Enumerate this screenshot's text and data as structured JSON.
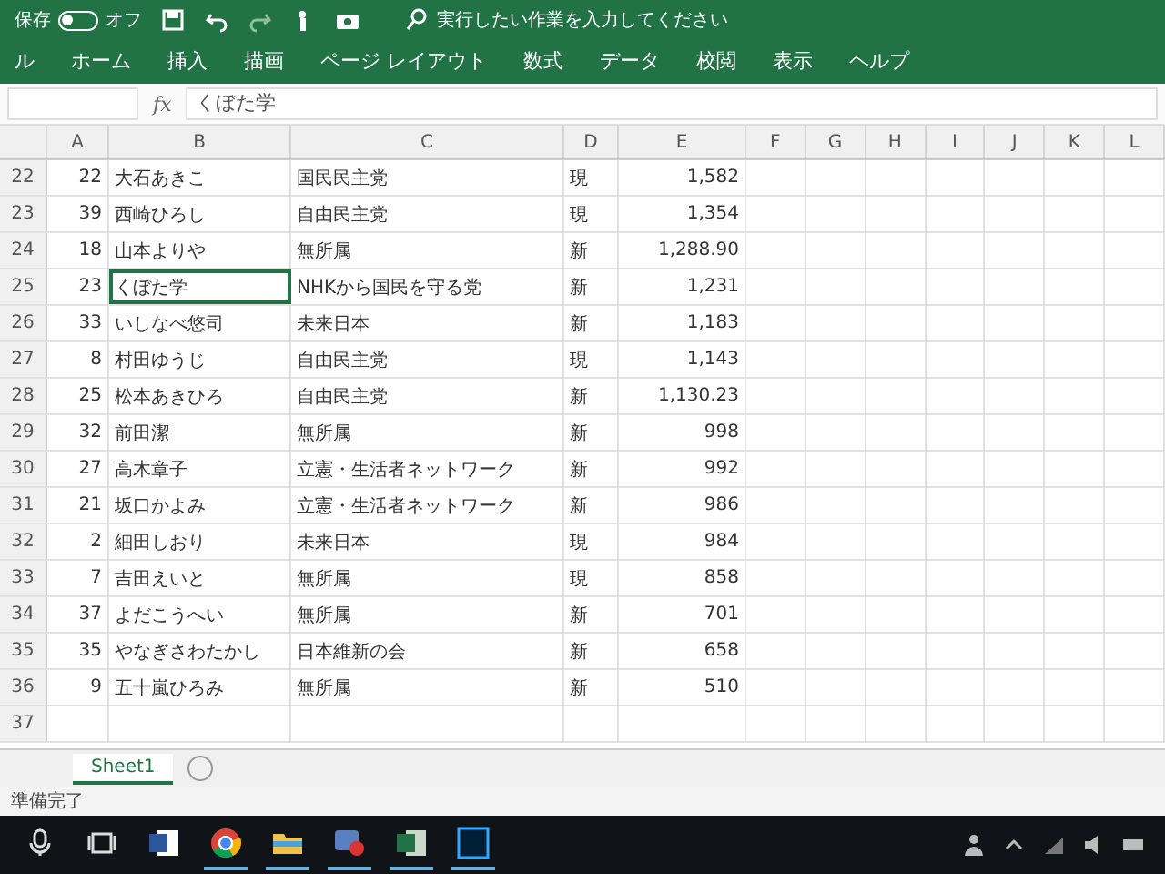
{
  "autosave": {
    "label": "保存",
    "state": "オフ",
    "on": false
  },
  "search": {
    "placeholder": "実行したい作業を入力してください"
  },
  "ribbon_tabs": [
    {
      "label": "ル",
      "selected": false
    },
    {
      "label": "ホーム",
      "selected": false
    },
    {
      "label": "挿入",
      "selected": false
    },
    {
      "label": "描画",
      "selected": false
    },
    {
      "label": "ページ レイアウト",
      "selected": false
    },
    {
      "label": "数式",
      "selected": false
    },
    {
      "label": "データ",
      "selected": false
    },
    {
      "label": "校閲",
      "selected": false
    },
    {
      "label": "表示",
      "selected": false
    },
    {
      "label": "ヘルプ",
      "selected": false
    }
  ],
  "formula_bar": {
    "fx": "fx",
    "value": "くぼた学"
  },
  "columns": [
    "A",
    "B",
    "C",
    "D",
    "E",
    "F",
    "G",
    "H",
    "I",
    "J",
    "K",
    "L"
  ],
  "rows": [
    {
      "row": "22",
      "a": "22",
      "b": "大石あきこ",
      "c": "国民民主党",
      "d": "現",
      "e": "1,582",
      "selected": false
    },
    {
      "row": "23",
      "a": "39",
      "b": "西崎ひろし",
      "c": "自由民主党",
      "d": "現",
      "e": "1,354",
      "selected": false
    },
    {
      "row": "24",
      "a": "18",
      "b": "山本よりや",
      "c": "無所属",
      "d": "新",
      "e": "1,288.90",
      "selected": false
    },
    {
      "row": "25",
      "a": "23",
      "b": "くぼた学",
      "c": "NHKから国民を守る党",
      "d": "新",
      "e": "1,231",
      "selected": true
    },
    {
      "row": "26",
      "a": "33",
      "b": "いしなべ悠司",
      "c": "未来日本",
      "d": "新",
      "e": "1,183",
      "selected": false
    },
    {
      "row": "27",
      "a": "8",
      "b": "村田ゆうじ",
      "c": "自由民主党",
      "d": "現",
      "e": "1,143",
      "selected": false
    },
    {
      "row": "28",
      "a": "25",
      "b": "松本あきひろ",
      "c": "自由民主党",
      "d": "新",
      "e": "1,130.23",
      "selected": false
    },
    {
      "row": "29",
      "a": "32",
      "b": "前田潔",
      "c": "無所属",
      "d": "新",
      "e": "998",
      "selected": false
    },
    {
      "row": "30",
      "a": "27",
      "b": "高木章子",
      "c": "立憲・生活者ネットワーク",
      "d": "新",
      "e": "992",
      "selected": false
    },
    {
      "row": "31",
      "a": "21",
      "b": "坂口かよみ",
      "c": "立憲・生活者ネットワーク",
      "d": "新",
      "e": "986",
      "selected": false
    },
    {
      "row": "32",
      "a": "2",
      "b": "細田しおり",
      "c": "未来日本",
      "d": "現",
      "e": "984",
      "selected": false
    },
    {
      "row": "33",
      "a": "7",
      "b": "吉田えいと",
      "c": "無所属",
      "d": "現",
      "e": "858",
      "selected": false
    },
    {
      "row": "34",
      "a": "37",
      "b": "よだこうへい",
      "c": "無所属",
      "d": "新",
      "e": "701",
      "selected": false
    },
    {
      "row": "35",
      "a": "35",
      "b": "やなぎさわたかし",
      "c": "日本維新の会",
      "d": "新",
      "e": "658",
      "selected": false
    },
    {
      "row": "36",
      "a": "9",
      "b": "五十嵐ひろみ",
      "c": "無所属",
      "d": "新",
      "e": "510",
      "selected": false
    },
    {
      "row": "37",
      "selected": false
    }
  ],
  "sheet_tabs": [
    {
      "label": "Sheet1",
      "selected": true
    }
  ],
  "status_bar": {
    "text": "準備完了"
  }
}
